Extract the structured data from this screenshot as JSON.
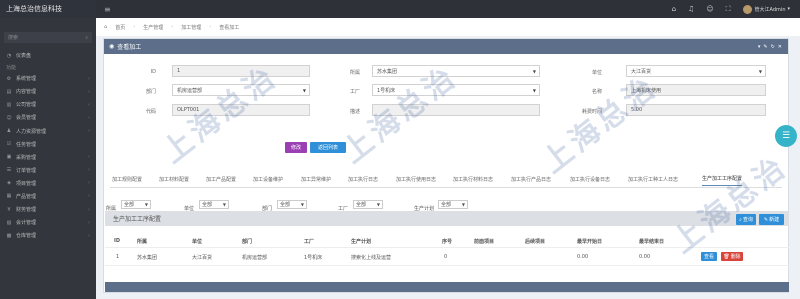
{
  "header": {
    "brand": "上海总治信息科技",
    "menu_icon": "≡",
    "user_name": "管大江Admin",
    "icons": [
      "house-icon",
      "bell-icon",
      "user-icon",
      "expand-icon"
    ]
  },
  "sidebar": {
    "search_placeholder": "搜索",
    "section_label": "功能",
    "items": [
      {
        "label": "仪表盘",
        "icon": "dashboard-icon"
      },
      {
        "label": "系统管理",
        "icon": "gear-icon"
      },
      {
        "label": "内容管理",
        "icon": "doc-icon"
      },
      {
        "label": "公司管理",
        "icon": "building-icon"
      },
      {
        "label": "会员管理",
        "icon": "user-icon"
      },
      {
        "label": "人力资源管理",
        "icon": "people-icon"
      },
      {
        "label": "任务管理",
        "icon": "task-icon"
      },
      {
        "label": "采购管理",
        "icon": "cart-icon"
      },
      {
        "label": "订单管理",
        "icon": "list-icon"
      },
      {
        "label": "项目管理",
        "icon": "project-icon"
      },
      {
        "label": "产品管理",
        "icon": "box-icon"
      },
      {
        "label": "财务管理",
        "icon": "money-icon"
      },
      {
        "label": "会计管理",
        "icon": "ledger-icon"
      },
      {
        "label": "仓库管理",
        "icon": "warehouse-icon"
      }
    ]
  },
  "breadcrumb": [
    "首页",
    "生产管理",
    "加工管理",
    "查看加工"
  ],
  "panel": {
    "title": "查看加工",
    "tools": [
      "chevron-down-icon",
      "wrench-icon",
      "refresh-icon",
      "close-icon"
    ]
  },
  "form": {
    "id_label": "ID",
    "id_value": "1",
    "company_label": "所属",
    "company_value": "苏水集团",
    "unit_label": "单位",
    "unit_value": "大江百货",
    "dept_label": "部门",
    "dept_value": "机房运营部",
    "factory_label": "工厂",
    "factory_value": "1号机床",
    "name_label": "名称",
    "name_value": "上海机床使用",
    "code_label": "代码",
    "code_value": "OLPT001",
    "desc_label": "描述",
    "desc_value": "",
    "time_label": "耗费时间",
    "time_value": "5.00"
  },
  "actions": {
    "edit": "修改",
    "back": "返回列表"
  },
  "tabs": [
    "加工规则配置",
    "加工材料配置",
    "加工产品配置",
    "加工设备维护",
    "加工异常维护",
    "加工执行日志",
    "加工执行使用日志",
    "加工执行材料日志",
    "加工执行产品日志",
    "加工执行设备日志",
    "加工执行工种工人日志",
    "生产加工工序配置"
  ],
  "active_tab_index": 11,
  "filters": {
    "company_label": "所属",
    "company_value": "全部",
    "unit_label": "单位",
    "unit_value": "全部",
    "dept_label": "部门",
    "dept_value": "全部",
    "factory_label": "工厂",
    "factory_value": "全部",
    "plan_label": "生产计划",
    "plan_value": "全部"
  },
  "subtable": {
    "title": "生产加工工序配置",
    "query_button": "查询",
    "add_button": "新建",
    "columns": [
      "ID",
      "所属",
      "单位",
      "部门",
      "工厂",
      "生产计划",
      "序号",
      "前面项目",
      "后续项目",
      "最早开始日",
      "最早结束日"
    ],
    "rows": [
      {
        "cells": [
          "1",
          "苏水集团",
          "大江百货",
          "机房运营部",
          "1号机床",
          "搜索化上线及运营",
          "0",
          "",
          "",
          "0.00",
          "0.00"
        ],
        "view": "查看",
        "delete": "删除"
      }
    ]
  },
  "watermark": "上海总治",
  "colors": {
    "topbar": "#2e3138",
    "sidebar": "#33363d",
    "panel_header": "#5d6e8a",
    "edit": "#9b3fb5",
    "back": "#2f8fd8",
    "view": "#2f8fd8",
    "delete": "#d9433a",
    "fab": "#35b3c8"
  }
}
